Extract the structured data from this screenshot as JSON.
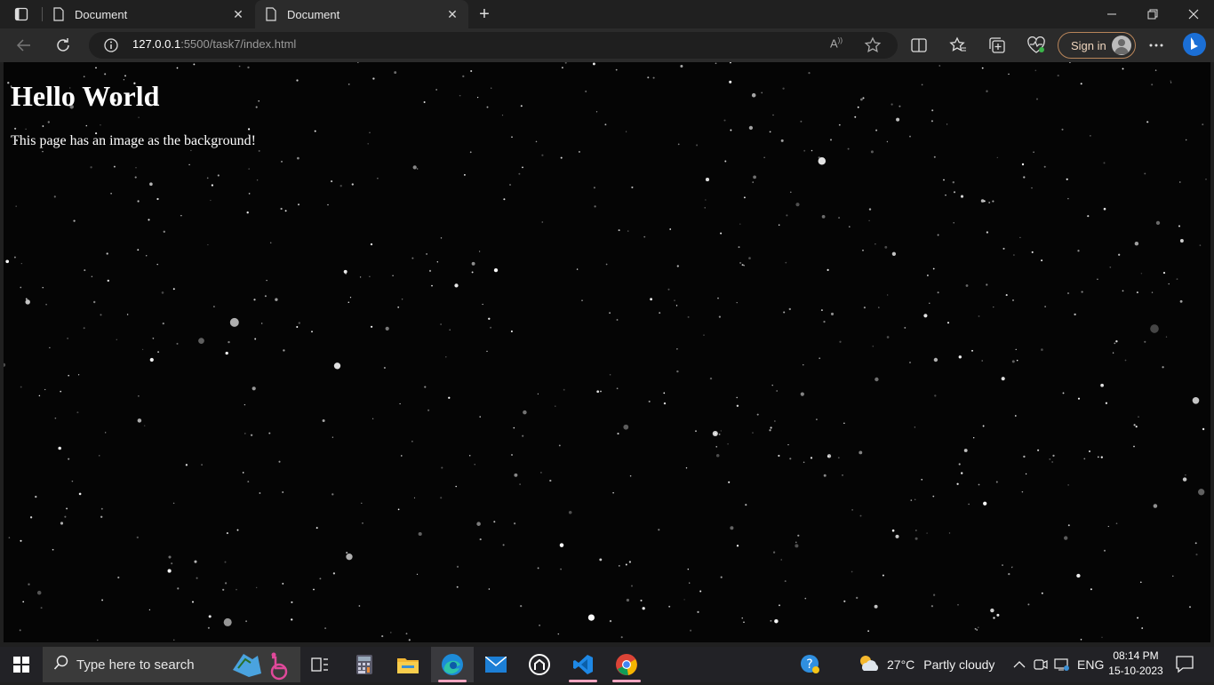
{
  "browser": {
    "tabs": [
      {
        "title": "Document"
      },
      {
        "title": "Document"
      }
    ],
    "url": {
      "host": "127.0.0.1",
      "rest": ":5500/task7/index.html"
    },
    "signin_label": "Sign in"
  },
  "page": {
    "heading": "Hello World",
    "paragraph": "This page has an image as the background!"
  },
  "taskbar": {
    "search_placeholder": "Type here to search",
    "weather": {
      "temp": "27°C",
      "condition": "Partly cloudy"
    },
    "language": "ENG",
    "time": "08:14 PM",
    "date": "15-10-2023"
  },
  "colors": {
    "accent_signin": "#b8855a",
    "taskbar_bg": "#222226",
    "page_bg": "#050505"
  }
}
